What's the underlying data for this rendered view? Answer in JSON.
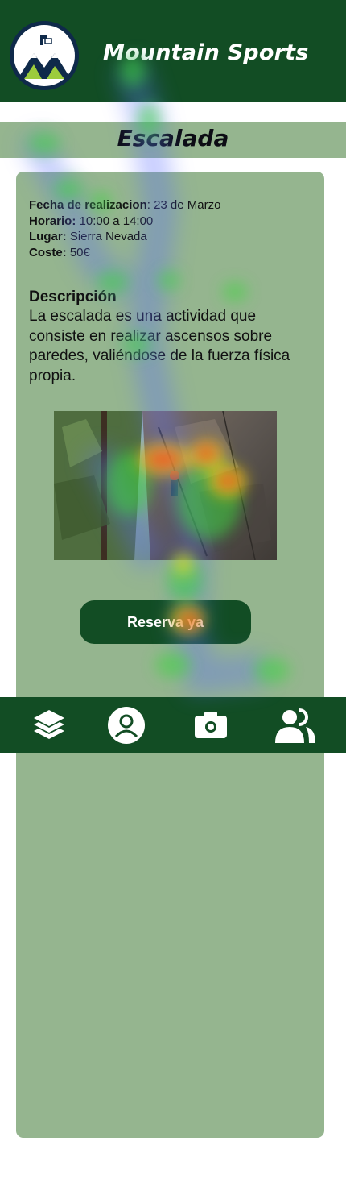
{
  "header": {
    "title": "Mountain Sports",
    "logo_icon": "mountain-logo-icon",
    "background": "#124d24"
  },
  "section": {
    "title": "Escalada"
  },
  "details": {
    "date_label": "Fecha de realizacion",
    "date_value": ": 23 de Marzo",
    "time_label": "Horario:",
    "time_value": " 10:00 a 14:00",
    "place_label": "Lugar:",
    "place_value": " Sierra Nevada",
    "cost_label": "Coste:",
    "cost_value": " 50€"
  },
  "description": {
    "title": "Descripción",
    "text": "La escalada es una actividad que consiste en realizar ascensos sobre paredes, valiéndose de la fuerza física propia."
  },
  "photo": {
    "icon": "climbing-photo"
  },
  "reserve_button": {
    "label": "Reserva ya"
  },
  "bottom_nav": {
    "items": [
      {
        "icon": "layers-icon"
      },
      {
        "icon": "profile-icon"
      },
      {
        "icon": "camera-icon"
      },
      {
        "icon": "group-icon"
      }
    ]
  },
  "colors": {
    "dark_green": "#124d24",
    "light_green": "#95b58f",
    "white": "#ffffff"
  }
}
